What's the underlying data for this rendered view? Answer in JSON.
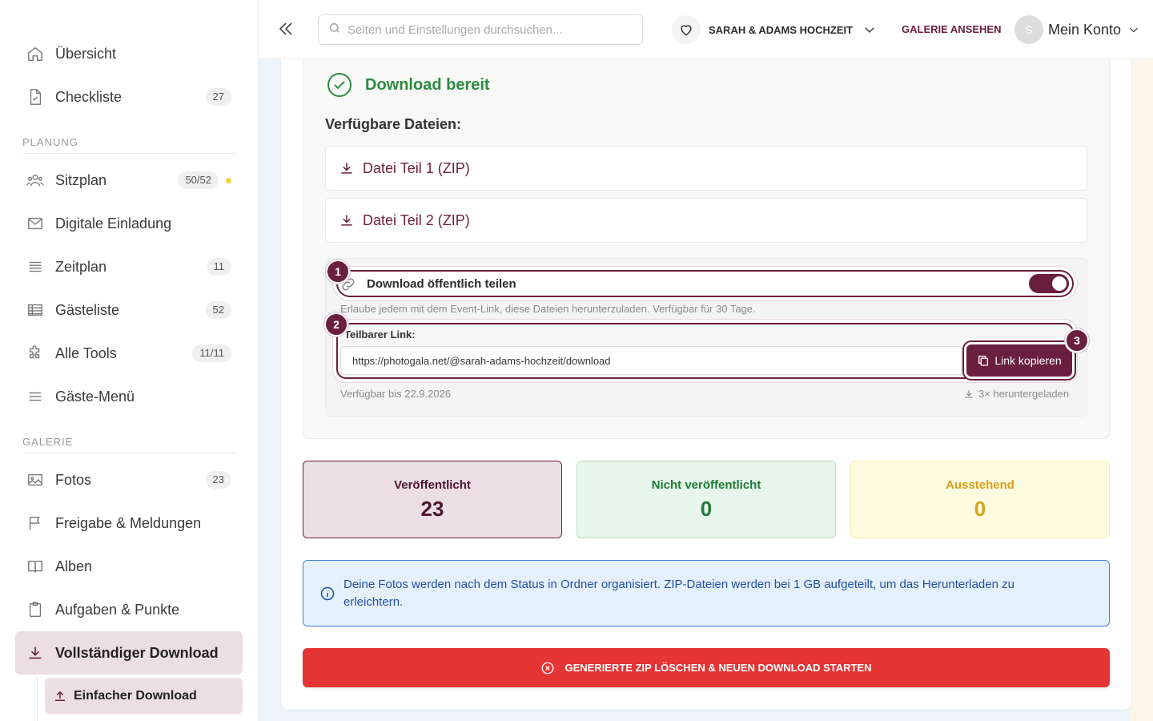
{
  "sidebar": {
    "items": [
      {
        "label": "Übersicht",
        "badge": ""
      },
      {
        "label": "Checkliste",
        "badge": "27"
      }
    ],
    "sections": {
      "planung": "PLANUNG",
      "galerie": "GALERIE"
    },
    "planung_items": [
      {
        "label": "Sitzplan",
        "badge": "50/52"
      },
      {
        "label": "Digitale Einladung",
        "badge": ""
      },
      {
        "label": "Zeitplan",
        "badge": "11"
      },
      {
        "label": "Gästeliste",
        "badge": "52"
      },
      {
        "label": "Alle Tools",
        "badge": "11/11"
      },
      {
        "label": "Gäste-Menü",
        "badge": ""
      }
    ],
    "galerie_items": [
      {
        "label": "Fotos",
        "badge": "23"
      },
      {
        "label": "Freigabe & Meldungen",
        "badge": ""
      },
      {
        "label": "Alben",
        "badge": ""
      },
      {
        "label": "Aufgaben & Punkte",
        "badge": ""
      },
      {
        "label": "Vollständiger Download",
        "badge": ""
      }
    ],
    "subnav_label": "Einfacher Download"
  },
  "topbar": {
    "search_placeholder": "Seiten und Einstellungen durchsuchen...",
    "event_name": "SARAH & ADAMS HOCHZEIT",
    "gallery_link": "GALERIE ANSEHEN",
    "avatar_initial": "S",
    "account_label": "Mein Konto"
  },
  "download": {
    "ready_title": "Download bereit",
    "files_title": "Verfügbare Dateien:",
    "files": [
      "Datei Teil 1 (ZIP)",
      "Datei Teil 2 (ZIP)"
    ],
    "share_label": "Download öffentlich teilen",
    "share_enabled": true,
    "share_desc": "Erlaube jedem mit dem Event-Link, diese Dateien herunterzuladen. Verfügbar für 30 Tage.",
    "link_label": "Teilbarer Link:",
    "link_value": "https://photogala.net/@sarah-adams-hochzeit/download",
    "copy_label": "Link kopieren",
    "available_until": "Verfügbar bis 22.9.2026",
    "download_count": "3× heruntergeladen",
    "steps": [
      "1",
      "2",
      "3"
    ]
  },
  "stats": [
    {
      "title": "Veröffentlicht",
      "value": "23"
    },
    {
      "title": "Nicht veröffentlicht",
      "value": "0"
    },
    {
      "title": "Ausstehend",
      "value": "0"
    }
  ],
  "info_text": "Deine Fotos werden nach dem Status in Ordner organisiert. ZIP-Dateien werden bei 1 GB aufgeteilt, um das Herunterladen zu erleichtern.",
  "danger_label": "GENERIERTE ZIP LÖSCHEN & NEUEN DOWNLOAD STARTEN",
  "colors": {
    "brand": "#6b1f3e",
    "success": "#2e8b3d",
    "danger": "#e53535",
    "info": "#1f4fa5",
    "pending": "#d9a01b"
  }
}
